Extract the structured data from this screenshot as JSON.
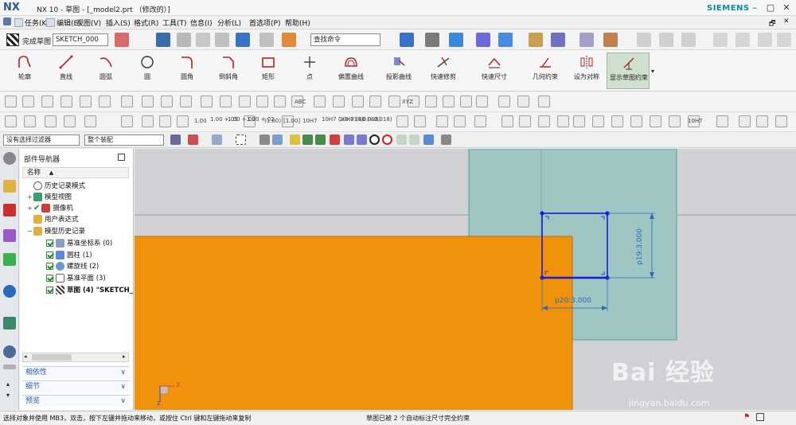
{
  "title_bar": {
    "logo": "NX",
    "title": "NX 10 - 草图 - [_model2.prt （修改的）]",
    "brand": "SIEMENS",
    "window_buttons": [
      "–",
      "▢",
      "✕"
    ]
  },
  "menu": {
    "items": [
      "任务(K)",
      "编辑(E)",
      "视图(V)",
      "插入(S)",
      "格式(R)",
      "工具(T)",
      "信息(I)",
      "分析(L)",
      "首选项(P)",
      "帮助(H)"
    ]
  },
  "toolbar": {
    "finish_sketch": "完成草图",
    "sketch_name": "SKETCH_000",
    "search_placeholder": "查找命令"
  },
  "ribbon": {
    "commands": [
      {
        "label": "轮廓",
        "icon": "profile-icon"
      },
      {
        "label": "直线",
        "icon": "line-icon"
      },
      {
        "label": "圆弧",
        "icon": "arc-icon"
      },
      {
        "label": "圆",
        "icon": "circle-icon"
      },
      {
        "label": "圆角",
        "icon": "fillet-icon"
      },
      {
        "label": "倒斜角",
        "icon": "chamfer-icon"
      },
      {
        "label": "矩形",
        "icon": "rectangle-icon"
      },
      {
        "label": "点",
        "icon": "point-icon"
      },
      {
        "label": "偏置曲线",
        "icon": "offset-curve-icon"
      },
      {
        "label": "投影曲线",
        "icon": "project-curve-icon"
      },
      {
        "label": "快速修剪",
        "icon": "quick-trim-icon"
      },
      {
        "label": "快速尺寸",
        "icon": "rapid-dimension-icon"
      },
      {
        "label": "几何约束",
        "icon": "geometric-constraint-icon"
      },
      {
        "label": "设为对称",
        "icon": "symmetric-icon"
      },
      {
        "label": "显示草图约束",
        "icon": "show-constraints-icon"
      }
    ]
  },
  "dim_toolbar": {
    "labels": [
      "ABC",
      "XYZ",
      "1.00",
      "1.00 +.05",
      "1.00 +.02",
      "1.00 +.02",
      "(1.00)",
      "[1.00]",
      "10H7",
      "10H7 (+0.018)",
      "10H7 (+0.018)",
      "10 (+0.018)",
      "10H7"
    ]
  },
  "selection_bar": {
    "filter": "没有选择过滤器",
    "scope": "整个装配"
  },
  "navigator": {
    "title": "部件导航器",
    "column": "名称",
    "nodes": [
      {
        "label": "历史记录模式"
      },
      {
        "label": "模型视图"
      },
      {
        "label": "摄像机"
      },
      {
        "label": "用户表达式"
      },
      {
        "label": "模型历史记录"
      },
      {
        "label": "基准坐标系 (0)"
      },
      {
        "label": "圆柱 (1)"
      },
      {
        "label": "螺旋线 (2)"
      },
      {
        "label": "基准平面 (3)"
      },
      {
        "label": "草图 (4) \"SKETCH_"
      }
    ],
    "panels": [
      "相依性",
      "细节",
      "预览"
    ]
  },
  "canvas": {
    "dimension_vertical": "p19:3.000",
    "dimension_horizontal": "p20:3.000",
    "triad_label": "X",
    "triad_label_z": "Z",
    "colors": {
      "solid": "#f0920b",
      "transparent_body": "#9ec6c3",
      "sketch": "#1a1ad6",
      "dimension": "#2a68b8"
    }
  },
  "watermark": {
    "brand": "Bai 经验",
    "url": "jingyan.baidu.com"
  },
  "status": {
    "left": "选择对象并使用 MB3，双击，按下左键并拖动来移动，或按住 Ctrl 键和左键拖动来复制",
    "middle": "草图已被 2 个自动标注尺寸完全约束"
  }
}
